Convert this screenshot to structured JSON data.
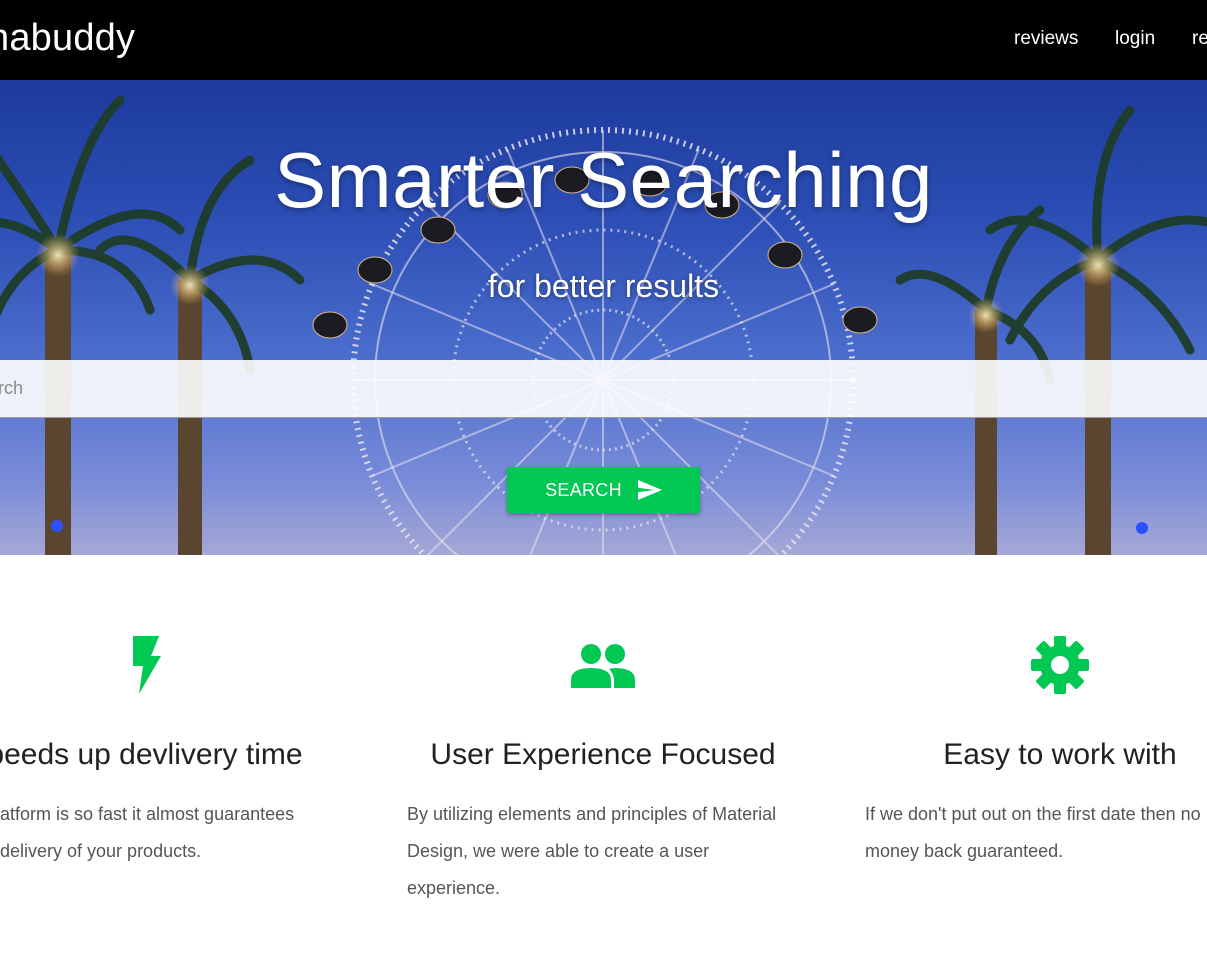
{
  "nav": {
    "brand": "nabuddy",
    "links": [
      "reviews",
      "login",
      "re"
    ]
  },
  "hero": {
    "title": "Smarter Searching",
    "subtitle": "for better results",
    "search_placeholder": "earch",
    "button_label": "SEARCH",
    "button_icon": "send-icon"
  },
  "features": [
    {
      "icon": "flash-icon",
      "title": "peeds up devlivery time",
      "text": [
        "atform is so fast it almost guarantees",
        "delivery of your products."
      ]
    },
    {
      "icon": "group-icon",
      "title": "User Experience Focused",
      "text": [
        "By utilizing elements and principles of Material",
        "Design, we were able to create a user",
        "experience."
      ]
    },
    {
      "icon": "settings-gear-icon",
      "title": "Easy to work with",
      "text": [
        "If we don't put out on the first date then no",
        "money back guaranteed."
      ]
    }
  ],
  "colors": {
    "accent": "#00c853",
    "navbar": "#000000",
    "sky": "#2d4fb6"
  }
}
